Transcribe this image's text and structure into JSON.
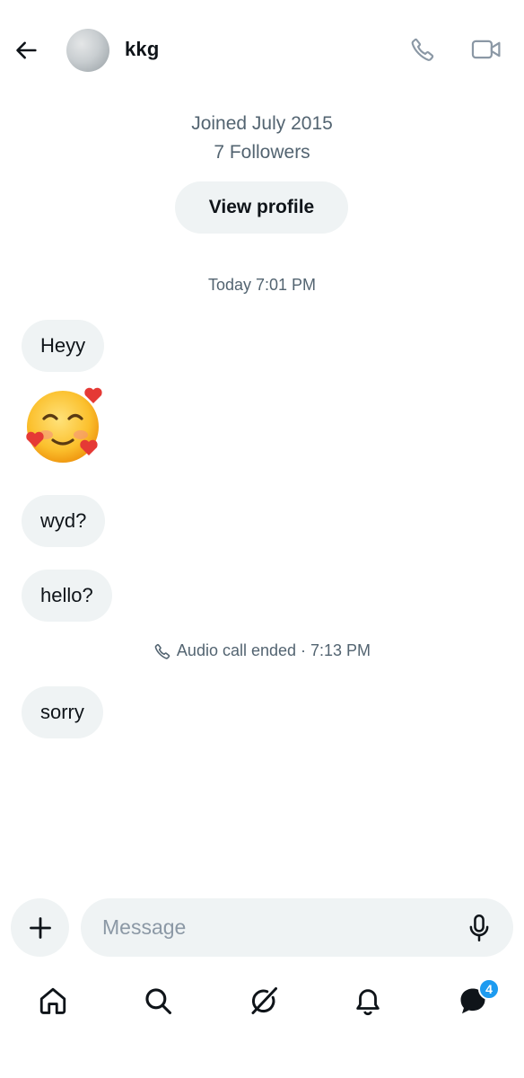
{
  "header": {
    "username": "kkg",
    "icons": {
      "back": "back-arrow-icon",
      "call": "phone-icon",
      "video": "video-camera-icon"
    }
  },
  "profile": {
    "joined": "Joined July 2015",
    "followers": "7 Followers",
    "view_profile_label": "View profile"
  },
  "conversation": {
    "timestamp": "Today 7:01 PM",
    "messages": [
      {
        "type": "text",
        "text": "Heyy"
      },
      {
        "type": "emoji",
        "emoji": "smiling-face-with-hearts"
      },
      {
        "type": "text",
        "text": "wyd?"
      },
      {
        "type": "text",
        "text": "hello?"
      },
      {
        "type": "call",
        "text": "Audio call ended · 7:13 PM"
      },
      {
        "type": "text",
        "text": "sorry"
      }
    ]
  },
  "composer": {
    "placeholder": "Message",
    "value": "",
    "icons": {
      "add": "plus-icon",
      "mic": "microphone-icon"
    }
  },
  "bottom_nav": {
    "items": [
      "home-icon",
      "search-icon",
      "grok-icon",
      "notifications-bell-icon",
      "messages-icon"
    ],
    "messages_badge": "4"
  },
  "colors": {
    "accent": "#1d9bf0",
    "bubble": "#eff3f4",
    "secondary_text": "#536471"
  }
}
